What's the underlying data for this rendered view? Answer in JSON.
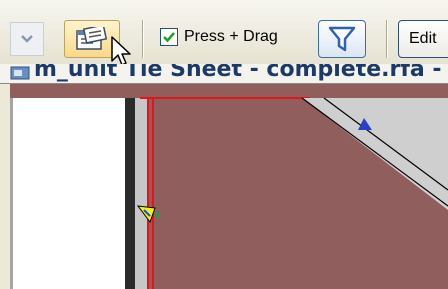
{
  "toolbar": {
    "press_drag_label": "Press + Drag",
    "press_drag_checked": true,
    "edit_label": "Edit"
  },
  "title_bar": {
    "text": "m_unit Tie Sheet - complete.rfa - S"
  },
  "icons": [
    "dropdown-arrow-icon",
    "properties-icon",
    "mouse-cursor-icon",
    "checkbox-check-icon",
    "filter-icon",
    "document-icon",
    "yellow-tag-marker-icon",
    "blue-marker-icon"
  ],
  "colors": {
    "toolbar_bg": "#ece9d8",
    "view_fill": "#8f5e5d",
    "red_line": "#e0161c",
    "filter_blue": "#2d61b6",
    "title_text": "#1a3a6a"
  }
}
